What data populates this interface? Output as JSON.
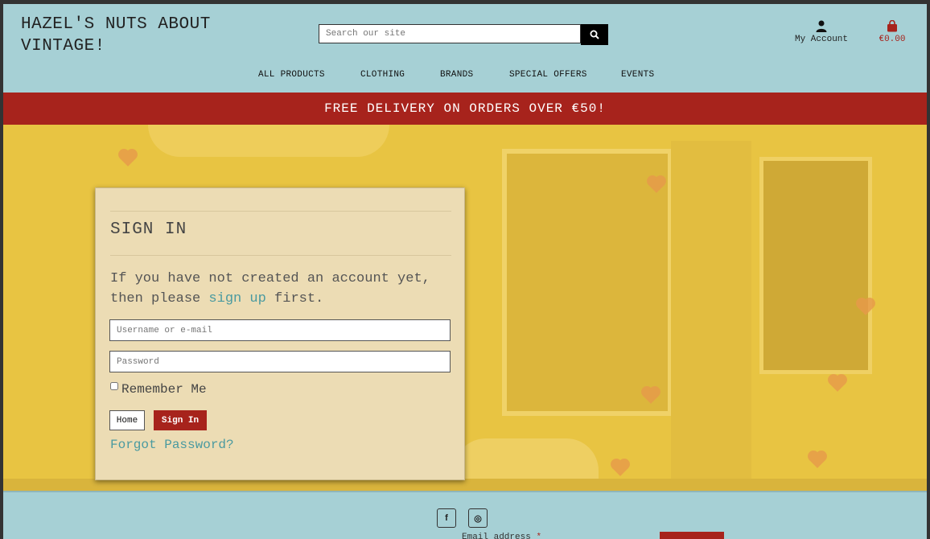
{
  "header": {
    "logo_line1": "HAZEL'S NUTS ABOUT",
    "logo_line2": "VINTAGE!",
    "search_placeholder": "Search our site",
    "account_label": "My Account",
    "cart_total": "€0.00"
  },
  "nav": [
    {
      "label": "ALL PRODUCTS"
    },
    {
      "label": "CLOTHING"
    },
    {
      "label": "BRANDS"
    },
    {
      "label": "SPECIAL OFFERS"
    },
    {
      "label": "EVENTS"
    }
  ],
  "banner": {
    "text": "FREE DELIVERY ON ORDERS OVER €50!"
  },
  "signin": {
    "title": "SIGN IN",
    "intro_before": "If you have not created an account yet, then please ",
    "signup_link": "sign up",
    "intro_after": " first.",
    "username_placeholder": "Username or e-mail",
    "password_placeholder": "Password",
    "remember_label": "Remember Me",
    "home_button": "Home",
    "signin_button": "Sign In",
    "forgot_link": "Forgot Password?"
  },
  "footer": {
    "facebook_glyph": "f",
    "instagram_glyph": "◎",
    "email_label": "Email address",
    "required_mark": "*"
  },
  "colors": {
    "header_bg": "#a6d0d5",
    "accent_red": "#a7231c",
    "hero_yellow": "#e8c442",
    "card_bg": "#ecdcb4",
    "link_teal": "#4a9aa0"
  }
}
